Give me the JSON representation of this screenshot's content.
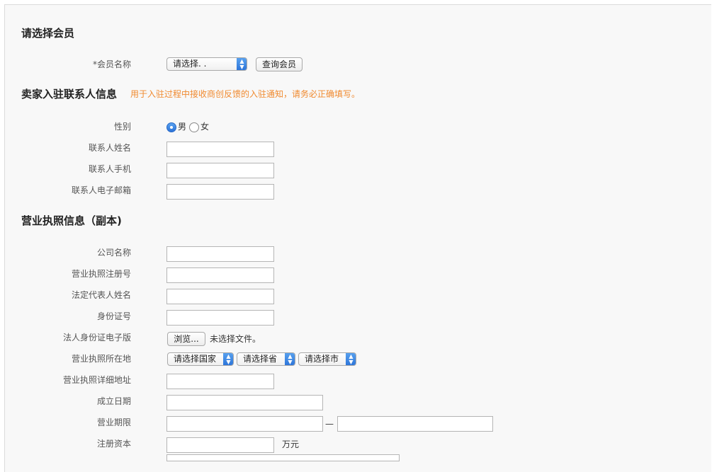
{
  "member_section": {
    "title": "请选择会员",
    "member_name_label": "*会员名称",
    "member_select_value": "请选择. .",
    "query_button": "查询会员"
  },
  "contact_section": {
    "title": "卖家入驻联系人信息",
    "note": "用于入驻过程中接收商创反馈的入驻通知，请务必正确填写。",
    "gender_label": "性别",
    "gender_male": "男",
    "gender_female": "女",
    "gender_selected": "男",
    "name_label": "联系人姓名",
    "phone_label": "联系人手机",
    "email_label": "联系人电子邮箱"
  },
  "license_section": {
    "title": "营业执照信息（副本)",
    "company_label": "公司名称",
    "reg_no_label": "营业执照注册号",
    "legal_rep_label": "法定代表人姓名",
    "id_no_label": "身份证号",
    "id_file_label": "法人身份证电子版",
    "browse_button": "浏览...",
    "no_file_text": "未选择文件。",
    "location_label": "营业执照所在地",
    "country_select": "请选择国家",
    "province_select": "请选择省",
    "city_select": "请选择市",
    "address_label": "营业执照详细地址",
    "founded_label": "成立日期",
    "term_label": "营业期限",
    "term_separator": "—",
    "capital_label": "注册资本",
    "capital_unit": "万元"
  },
  "colors": {
    "note_orange": "#f08a30",
    "select_blue": "#2b73d8"
  }
}
